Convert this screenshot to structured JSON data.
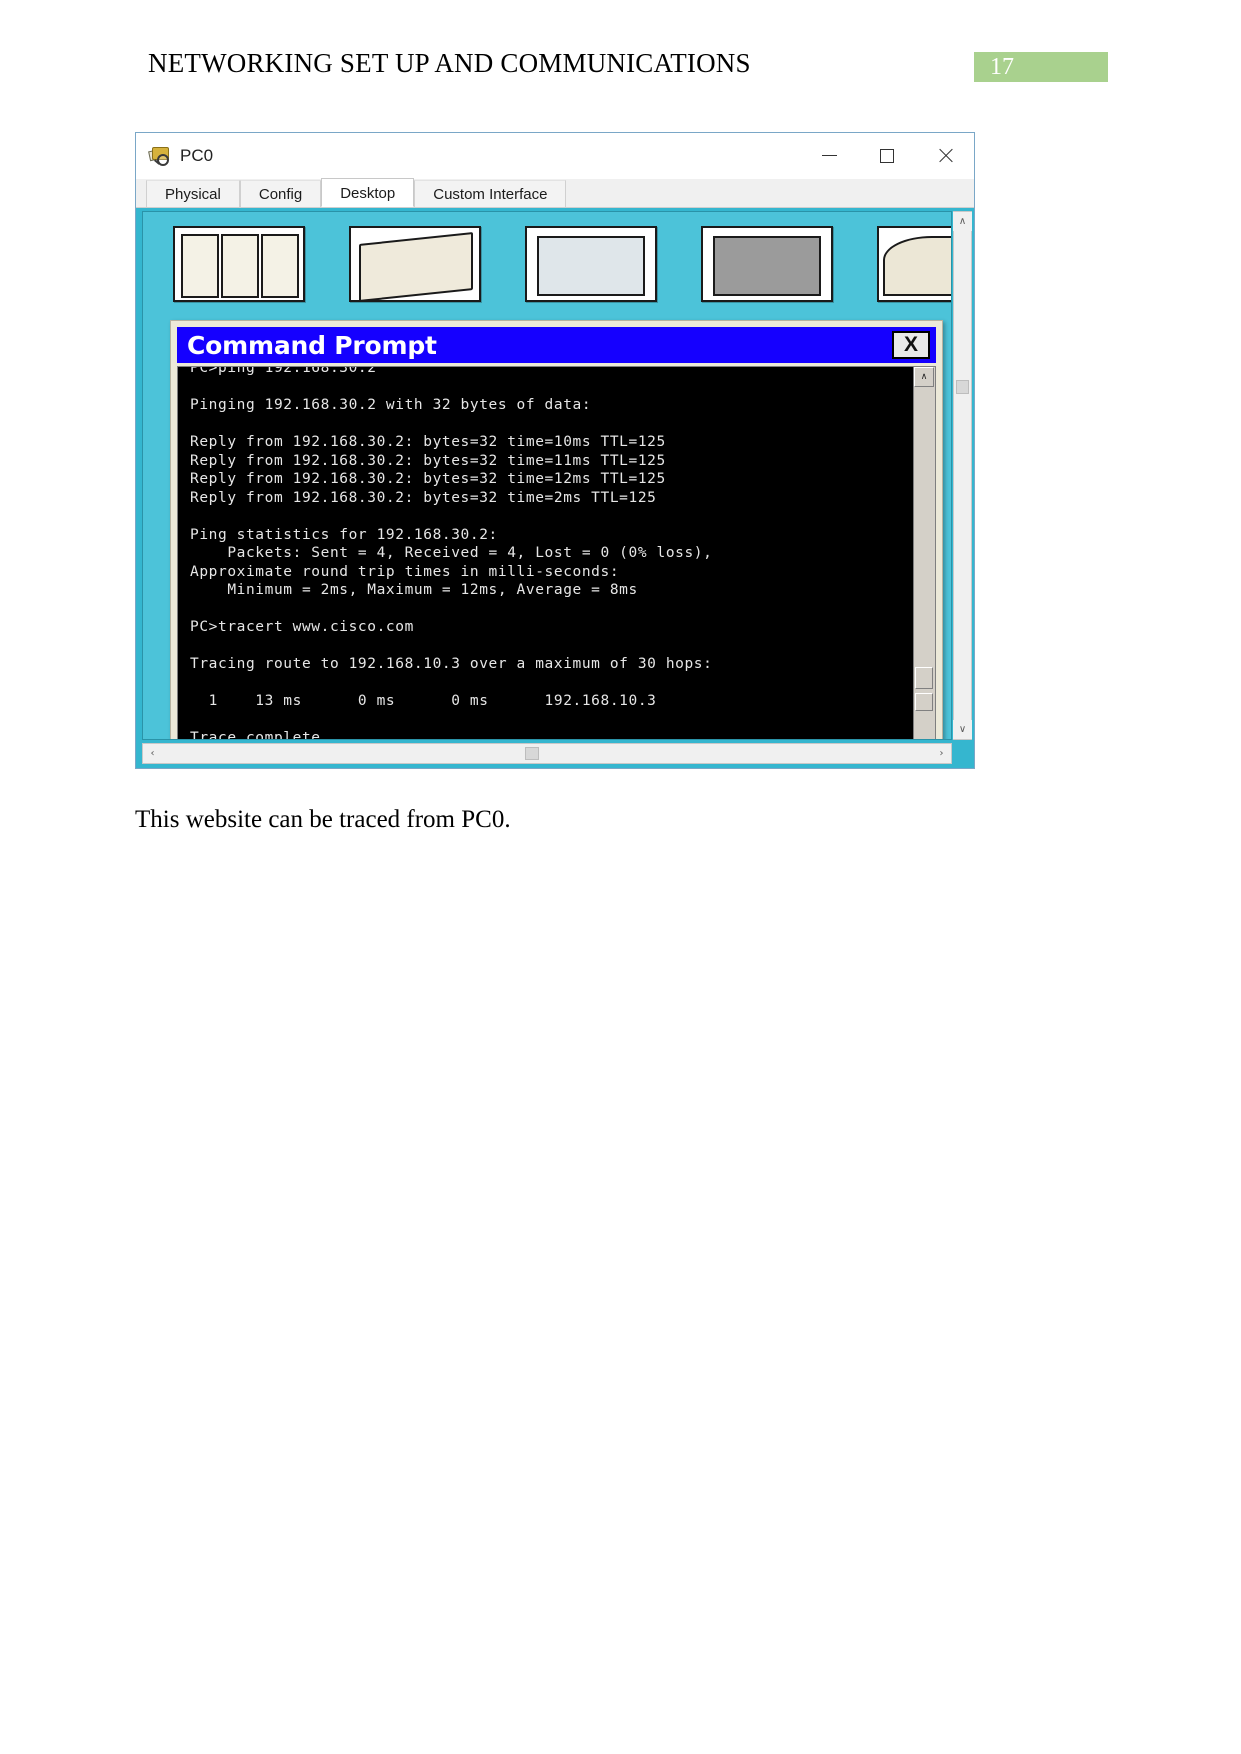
{
  "document": {
    "heading": "NETWORKING SET UP AND COMMUNICATIONS",
    "page_number": "17",
    "caption": "This website can be traced from PC0.",
    "accent_green": "#a9d18e"
  },
  "window": {
    "title": "PC0",
    "icon": "packet-tracer-device-icon",
    "controls": {
      "minimize": "–",
      "maximize": "□",
      "close": "✕"
    },
    "tabs": [
      {
        "label": "Physical",
        "active": false
      },
      {
        "label": "Config",
        "active": false
      },
      {
        "label": "Desktop",
        "active": true
      },
      {
        "label": "Custom Interface",
        "active": false
      }
    ]
  },
  "desktop": {
    "background_color": "#4cc3d9",
    "app_tiles": [
      "app-tile-1",
      "app-tile-2",
      "app-tile-3",
      "app-tile-4",
      "app-tile-5"
    ]
  },
  "command_prompt": {
    "title": "Command Prompt",
    "close_label": "X",
    "titlebar_color": "#1500ff",
    "console_bg": "#000000",
    "console_fg": "#e6e6e6",
    "scroll_up_glyph": "∧",
    "scroll_down_glyph": "∨",
    "output": "PC>ping 192.168.30.2\n\nPinging 192.168.30.2 with 32 bytes of data:\n\nReply from 192.168.30.2: bytes=32 time=10ms TTL=125\nReply from 192.168.30.2: bytes=32 time=11ms TTL=125\nReply from 192.168.30.2: bytes=32 time=12ms TTL=125\nReply from 192.168.30.2: bytes=32 time=2ms TTL=125\n\nPing statistics for 192.168.30.2:\n    Packets: Sent = 4, Received = 4, Lost = 0 (0% loss),\nApproximate round trip times in milli-seconds:\n    Minimum = 2ms, Maximum = 12ms, Average = 8ms\n\nPC>tracert www.cisco.com\n\nTracing route to 192.168.10.3 over a maximum of 30 hops:\n\n  1    13 ms      0 ms      0 ms      192.168.10.3\n\nTrace complete.\n\nPC>",
    "prompt": "PC>"
  },
  "scrollbars": {
    "left_arrow": "‹",
    "right_arrow": "›",
    "up_arrow": "∧",
    "down_arrow": "∨"
  }
}
